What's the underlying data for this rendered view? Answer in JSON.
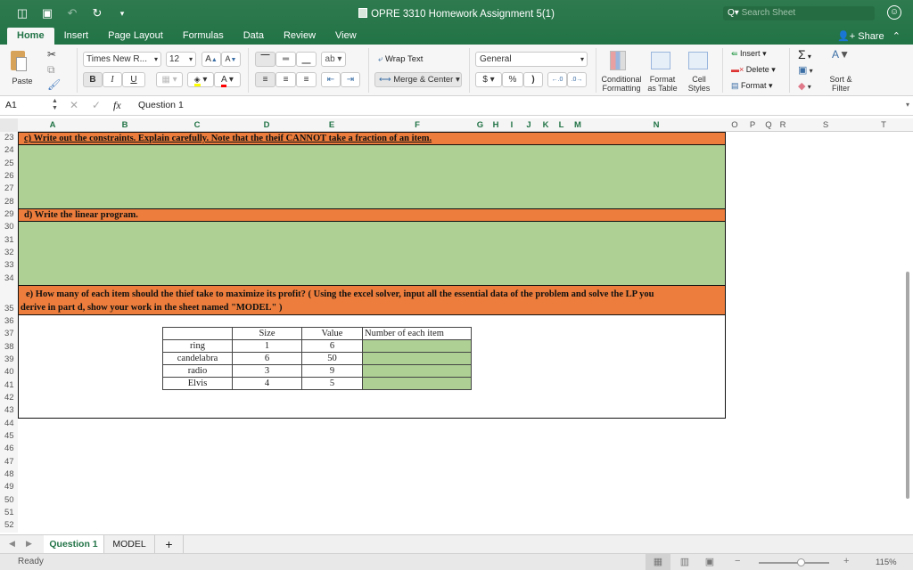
{
  "window": {
    "title": "OPRE 3310 Homework Assignment 5(1)",
    "search_placeholder": "Search Sheet"
  },
  "quick_access": [
    "sidebar-toggle",
    "save",
    "undo",
    "redo",
    "customize"
  ],
  "tabs": [
    {
      "label": "Home",
      "active": true
    },
    {
      "label": "Insert"
    },
    {
      "label": "Page Layout"
    },
    {
      "label": "Formulas"
    },
    {
      "label": "Data"
    },
    {
      "label": "Review"
    },
    {
      "label": "View"
    }
  ],
  "share_label": "Share",
  "ribbon": {
    "paste": "Paste",
    "font_name": "Times New R...",
    "font_size": "12",
    "bold": "B",
    "italic": "I",
    "underline": "U",
    "wrap_text": "Wrap Text",
    "merge_center": "Merge & Center",
    "number_format": "General",
    "currency": "$",
    "percent": "%",
    "comma": ")",
    "inc_decimal": "←.0 .00",
    "dec_decimal": ".00 →.0",
    "conditional_formatting": [
      "Conditional",
      "Formatting"
    ],
    "format_as_table": [
      "Format",
      "as Table"
    ],
    "cell_styles": [
      "Cell",
      "Styles"
    ],
    "insert": "Insert",
    "delete": "Delete",
    "format": "Format",
    "sort_filter": [
      "Sort &",
      "Filter"
    ],
    "fill_color": "#ffff00",
    "font_color": "#ff0000"
  },
  "formula_bar": {
    "name_box": "A1",
    "fx": "fx",
    "content": "Question 1"
  },
  "columns": [
    "A",
    "B",
    "C",
    "D",
    "E",
    "F",
    "G",
    "H",
    "I",
    "J",
    "K",
    "L",
    "M",
    "N",
    "O",
    "P",
    "Q",
    "R",
    "S",
    "T"
  ],
  "rows": [
    "23",
    "24",
    "25",
    "26",
    "27",
    "28",
    "29",
    "30",
    "31",
    "32",
    "33",
    "34",
    "35",
    "36",
    "37",
    "38",
    "39",
    "40",
    "41",
    "42",
    "43",
    "44",
    "45",
    "46",
    "47",
    "48",
    "49",
    "50",
    "51",
    "52"
  ],
  "sheet": {
    "c_text": "c) Write out the constraints. Explain carefully. Note that the theif CANNOT take a fraction of an item.",
    "d_text": "d) Write the linear program.",
    "e_line1": "e) How many of each item should the thief take to maximize its profit? ( Using the excel solver, input all the essential data of the problem and solve the LP you",
    "e_line2": "derive in part d, show your work in the sheet named \"MODEL\" )",
    "colors": {
      "header_band": "#ec7d3c",
      "answer_band": "#aed094"
    },
    "table": {
      "headers": [
        "",
        "Size",
        "Value",
        "Number of each item"
      ],
      "rows": [
        {
          "item": "ring",
          "size": "1",
          "value": "6",
          "number": ""
        },
        {
          "item": "candelabra",
          "size": "6",
          "value": "50",
          "number": ""
        },
        {
          "item": "radio",
          "size": "3",
          "value": "9",
          "number": ""
        },
        {
          "item": "Elvis",
          "size": "4",
          "value": "5",
          "number": ""
        }
      ]
    }
  },
  "sheet_tabs": [
    {
      "label": "Question 1",
      "active": true
    },
    {
      "label": "MODEL"
    }
  ],
  "add_sheet": "+",
  "status": {
    "text": "Ready",
    "zoom": "115%",
    "zoom_level_percent": 115
  }
}
